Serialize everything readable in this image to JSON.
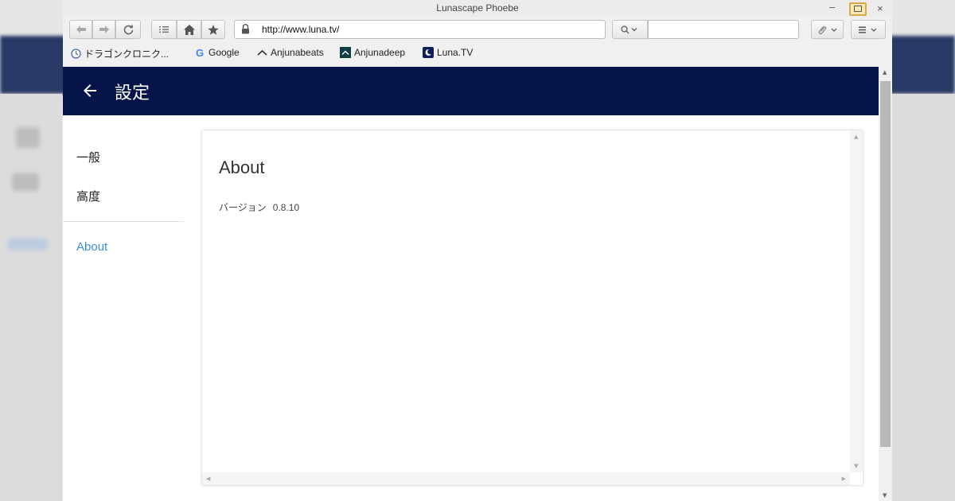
{
  "window": {
    "title": "Lunascape Phoebe"
  },
  "toolbar": {
    "url": "http://www.luna.tv/",
    "search_value": ""
  },
  "bookmarks": [
    {
      "label": "ドラゴンクロニク...",
      "icon": "clock-icon"
    },
    {
      "label": "Google",
      "icon": "google-icon"
    },
    {
      "label": "Anjunabeats",
      "icon": "anjunabeats-icon"
    },
    {
      "label": "Anjunadeep",
      "icon": "anjunadeep-icon"
    },
    {
      "label": "Luna.TV",
      "icon": "moon-icon"
    }
  ],
  "appbar": {
    "title": "設定"
  },
  "nav": {
    "items": [
      {
        "label": "一般"
      },
      {
        "label": "高度"
      },
      {
        "label": "About"
      }
    ]
  },
  "about": {
    "title": "About",
    "version_label": "バージョン",
    "version_value": "0.8.10"
  },
  "colors": {
    "appbar": "#07144a",
    "active_nav": "#3b8ed8",
    "restore_highlight": "#fbe9b8"
  }
}
